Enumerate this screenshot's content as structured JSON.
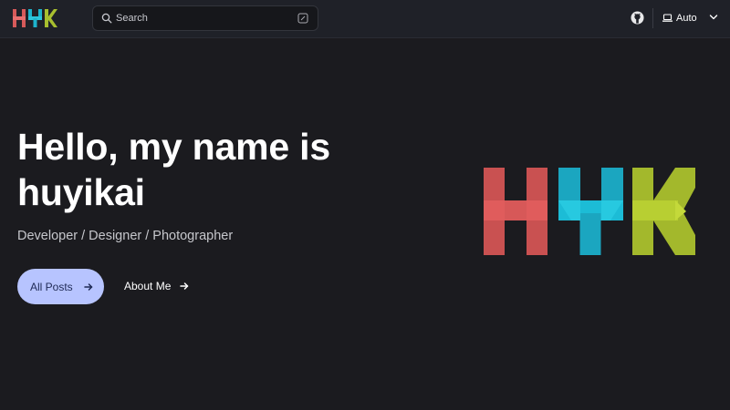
{
  "nav": {
    "logo_letters": [
      "H",
      "Y",
      "K"
    ],
    "search_placeholder": "Search",
    "theme_mode": "Auto",
    "icons": [
      "search-icon",
      "search-shortcut-icon",
      "github-icon",
      "laptop-icon",
      "chevron-down-icon"
    ]
  },
  "hero": {
    "headline": "Hello, my name is huyikai",
    "tagline": "Developer / Designer / Photographer",
    "primary_button": "All Posts",
    "secondary_button": "About Me"
  },
  "colors": {
    "background": "#1b1b1f",
    "navbar": "#1f2128",
    "primary_button": "#b7c4ff",
    "logo_red": "#c95151",
    "logo_blue": "#1ba6c0",
    "logo_green": "#a3b82c"
  }
}
